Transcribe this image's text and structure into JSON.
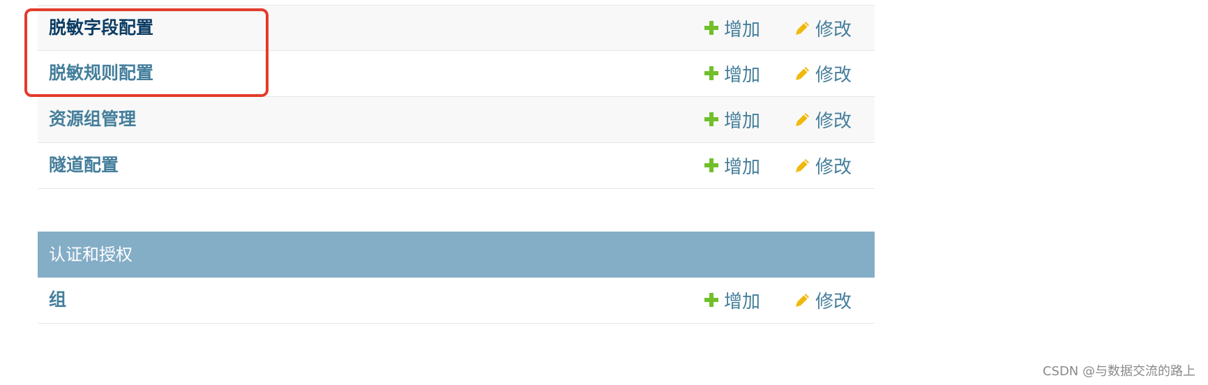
{
  "modules": [
    {
      "rows": [
        {
          "name": "脱敏字段配置",
          "add_label": "增加",
          "change_label": "修改"
        },
        {
          "name": "脱敏规则配置",
          "add_label": "增加",
          "change_label": "修改"
        },
        {
          "name": "资源组管理",
          "add_label": "增加",
          "change_label": "修改"
        },
        {
          "name": "隧道配置",
          "add_label": "增加",
          "change_label": "修改"
        }
      ]
    },
    {
      "caption": "认证和授权",
      "rows": [
        {
          "name": "组",
          "add_label": "增加",
          "change_label": "修改"
        }
      ]
    }
  ],
  "icons": {
    "add": "plus-icon",
    "change": "pencil-icon"
  },
  "colors": {
    "link": "#447e9b",
    "link_current": "#0c3c63",
    "add_icon": "#70bf2b",
    "change_icon": "#efb80b",
    "module_header_bg": "#84adc6",
    "highlight_border": "#e33b2b"
  },
  "watermark": "CSDN @与数据交流的路上"
}
